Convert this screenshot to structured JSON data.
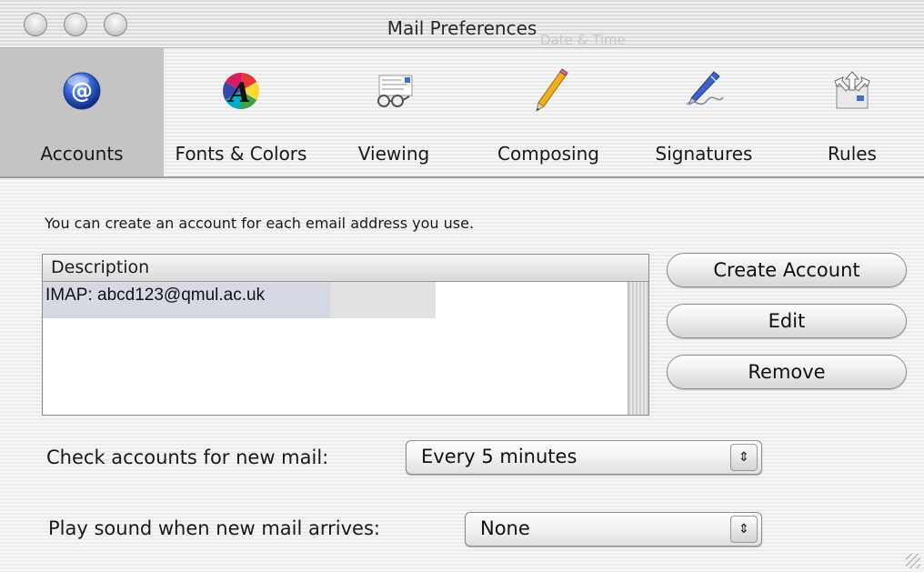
{
  "window": {
    "title": "Mail Preferences",
    "behind_title": "Date & Time"
  },
  "toolbar": {
    "items": [
      {
        "label": "Accounts",
        "icon": "at-sign-icon",
        "selected": true
      },
      {
        "label": "Fonts & Colors",
        "icon": "fonts-colors-icon",
        "selected": false
      },
      {
        "label": "Viewing",
        "icon": "viewing-glasses-icon",
        "selected": false
      },
      {
        "label": "Composing",
        "icon": "pencil-icon",
        "selected": false
      },
      {
        "label": "Signatures",
        "icon": "pen-signature-icon",
        "selected": false
      },
      {
        "label": "Rules",
        "icon": "rules-arrows-icon",
        "selected": false
      }
    ]
  },
  "accounts": {
    "info_text": "You can create an account for each email address you use.",
    "column_header": "Description",
    "rows": [
      "IMAP: abcd123@qmul.ac.uk"
    ],
    "buttons": {
      "create": "Create Account",
      "edit": "Edit",
      "remove": "Remove"
    }
  },
  "check_mail": {
    "label": "Check accounts for new mail:",
    "value": "Every 5 minutes"
  },
  "sound": {
    "label": "Play sound when new mail arrives:",
    "value": "None"
  },
  "colors": {
    "selected_tab": "#c4c4c4",
    "selected_row": "#d4d9e4",
    "accent_blue": "#2f5fd0"
  }
}
